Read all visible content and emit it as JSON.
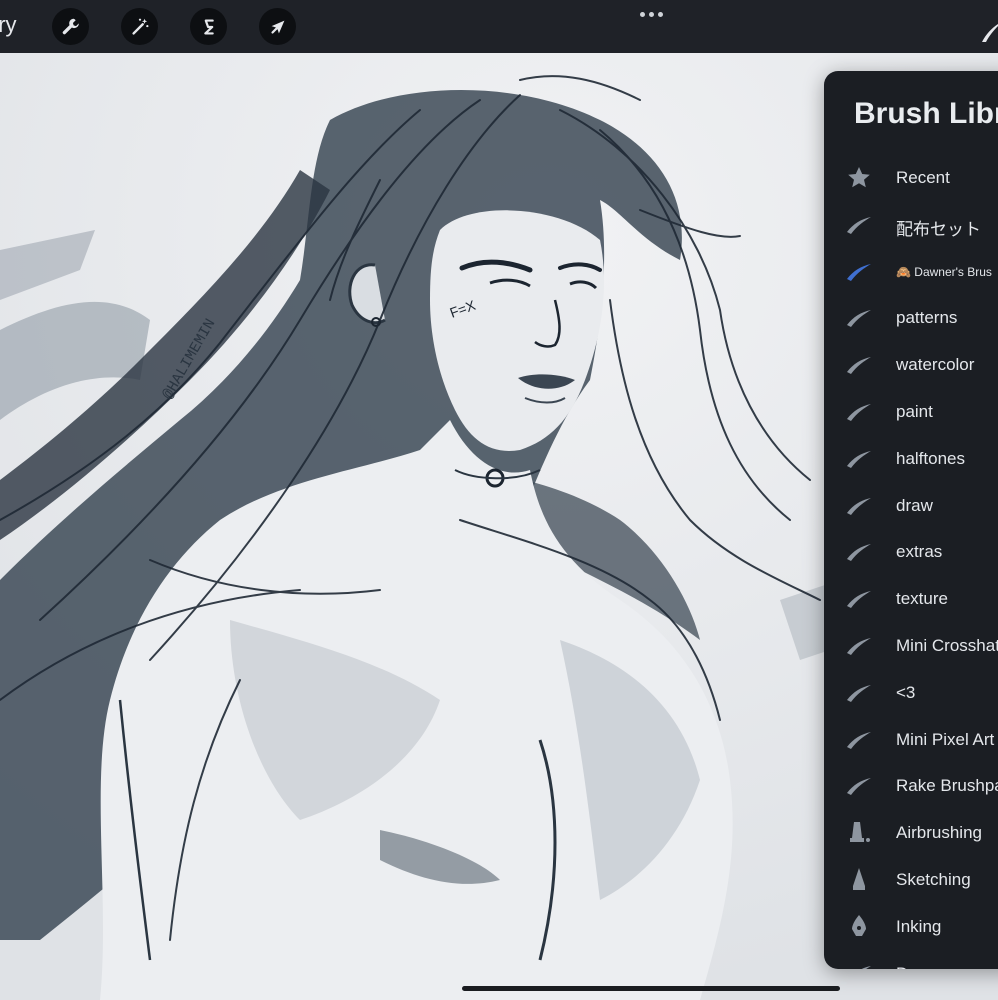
{
  "toolbar": {
    "gallery_label": "ery",
    "tools": [
      {
        "name": "wrench-icon"
      },
      {
        "name": "magic-wand-icon"
      },
      {
        "name": "selection-icon"
      },
      {
        "name": "transform-arrow-icon"
      }
    ],
    "more_icon": "ellipsis-icon"
  },
  "canvas": {
    "signature": "@HALIMEMIN",
    "face_mark": "F=X"
  },
  "brush_library": {
    "title": "Brush Libr",
    "items": [
      {
        "label": "Recent",
        "icon": "star-icon"
      },
      {
        "label": "配布セット",
        "icon": "brush-stroke-icon"
      },
      {
        "label": "🙈 Dawner's Brus",
        "icon": "brush-stroke-blue-icon",
        "selected": true
      },
      {
        "label": "patterns",
        "icon": "brush-stroke-icon"
      },
      {
        "label": "watercolor",
        "icon": "brush-stroke-icon"
      },
      {
        "label": "paint",
        "icon": "brush-stroke-icon"
      },
      {
        "label": "halftones",
        "icon": "brush-stroke-icon"
      },
      {
        "label": "draw",
        "icon": "brush-stroke-icon"
      },
      {
        "label": "extras",
        "icon": "brush-stroke-icon"
      },
      {
        "label": "texture",
        "icon": "brush-stroke-icon"
      },
      {
        "label": "Mini Crosshatc",
        "icon": "brush-stroke-icon"
      },
      {
        "label": "<3",
        "icon": "brush-stroke-icon"
      },
      {
        "label": "Mini Pixel Art",
        "icon": "brush-stroke-icon"
      },
      {
        "label": "Rake Brushpa",
        "icon": "brush-stroke-icon"
      },
      {
        "label": "Airbrushing",
        "icon": "airbrush-icon"
      },
      {
        "label": "Sketching",
        "icon": "pencil-tip-icon"
      },
      {
        "label": "Inking",
        "icon": "pen-nib-icon"
      },
      {
        "label": "D",
        "icon": "brush-stroke-icon"
      }
    ]
  },
  "colors": {
    "toolbar_bg": "#1f2228",
    "panel_bg": "#1b1e23",
    "accent_blue": "#3f6fd0",
    "ink": "#1c2530"
  }
}
